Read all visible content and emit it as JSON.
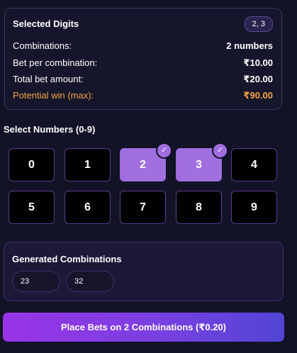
{
  "summary": {
    "title": "Selected Digits",
    "badge": "2, 3",
    "rows": [
      {
        "label": "Combinations:",
        "value": "2 numbers"
      },
      {
        "label": "Bet per combination:",
        "value": "₹10.00"
      },
      {
        "label": "Total bet amount:",
        "value": "₹20.00"
      },
      {
        "label": "Potential win (max):",
        "value": "₹90.00"
      }
    ]
  },
  "select": {
    "title": "Select Numbers (0-9)",
    "digits": [
      {
        "label": "0",
        "selected": false
      },
      {
        "label": "1",
        "selected": false
      },
      {
        "label": "2",
        "selected": true
      },
      {
        "label": "3",
        "selected": true
      },
      {
        "label": "4",
        "selected": false
      },
      {
        "label": "5",
        "selected": false
      },
      {
        "label": "6",
        "selected": false
      },
      {
        "label": "7",
        "selected": false
      },
      {
        "label": "8",
        "selected": false
      },
      {
        "label": "9",
        "selected": false
      }
    ],
    "check_glyph": "✓"
  },
  "combinations": {
    "title": "Generated Combinations",
    "items": [
      "23",
      "32"
    ]
  },
  "place_button": {
    "label": "Place Bets on 2 Combinations (₹0.20)"
  },
  "colors": {
    "background": "#121326",
    "accent": "#a16ee0",
    "win": "#f5a445",
    "button_gradient": [
      "#9834e6",
      "#5145d6"
    ]
  }
}
